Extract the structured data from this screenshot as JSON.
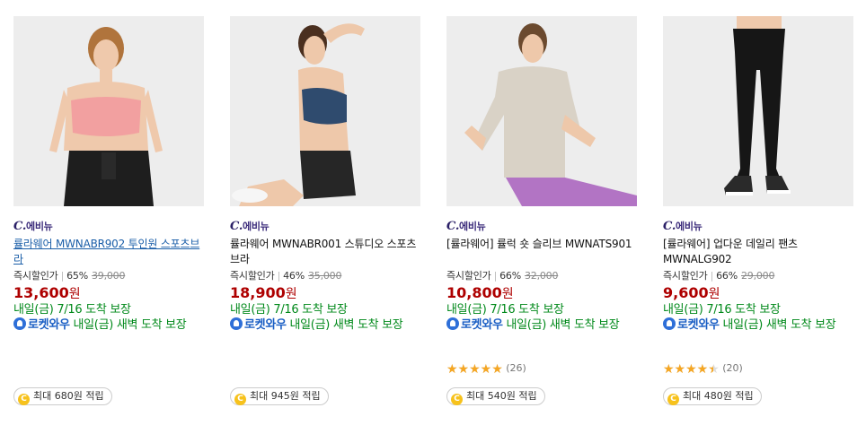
{
  "products": [
    {
      "brand_mark": "C.",
      "brand_name": "에비뉴",
      "name": "률라웨어 MWNABR902 투인원 스포츠브라",
      "name_linked": true,
      "discount_label": "즉시할인가",
      "discount_rate": "65%",
      "original_price": "39,000",
      "price": "13,600",
      "price_unit": "원",
      "delivery": "내일(금) 7/16 도착 보장",
      "rocket_name": "로켓와우",
      "rocket_text": "내일(금) 새벽 도착 보장",
      "rating": null,
      "review_count": "",
      "reward_icon": "C",
      "reward_text": "최대 680원 적립",
      "image": "model-pink-sports-bra"
    },
    {
      "brand_mark": "C.",
      "brand_name": "에비뉴",
      "name": "률라웨어 MWNABR001 스튜디오 스포츠 브라",
      "name_linked": false,
      "discount_label": "즉시할인가",
      "discount_rate": "46%",
      "original_price": "35,000",
      "price": "18,900",
      "price_unit": "원",
      "delivery": "내일(금) 7/16 도착 보장",
      "rocket_name": "로켓와우",
      "rocket_text": "내일(금) 새벽 도착 보장",
      "rating": null,
      "review_count": "",
      "reward_icon": "C",
      "reward_text": "최대 945원 적립",
      "image": "model-navy-sports-bra"
    },
    {
      "brand_mark": "C.",
      "brand_name": "에비뉴",
      "name": "[률라웨어] 률럭 숏 슬리브 MWNATS901",
      "name_linked": false,
      "discount_label": "즉시할인가",
      "discount_rate": "66%",
      "original_price": "32,000",
      "price": "10,800",
      "price_unit": "원",
      "delivery": "내일(금) 7/16 도착 보장",
      "rocket_name": "로켓와우",
      "rocket_text": "내일(금) 새벽 도착 보장",
      "rating": 5,
      "review_count": "(26)",
      "reward_icon": "C",
      "reward_text": "최대 540원 적립",
      "image": "model-beige-short-sleeve"
    },
    {
      "brand_mark": "C.",
      "brand_name": "에비뉴",
      "name": "[률라웨어] 업다운 데일리 팬츠 MWNALG902",
      "name_linked": false,
      "discount_label": "즉시할인가",
      "discount_rate": "66%",
      "original_price": "29,000",
      "price": "9,600",
      "price_unit": "원",
      "delivery": "내일(금) 7/16 도착 보장",
      "rocket_name": "로켓와우",
      "rocket_text": "내일(금) 새벽 도착 보장",
      "rating": 4.5,
      "review_count": "(20)",
      "reward_icon": "C",
      "reward_text": "최대 480원 적립",
      "image": "model-black-leggings"
    }
  ],
  "colors": {
    "price": "#ae0000",
    "delivery": "#00891a",
    "rocket_badge": "#2e6fd8",
    "star": "#f5a623",
    "coin": "#f7c21c"
  }
}
